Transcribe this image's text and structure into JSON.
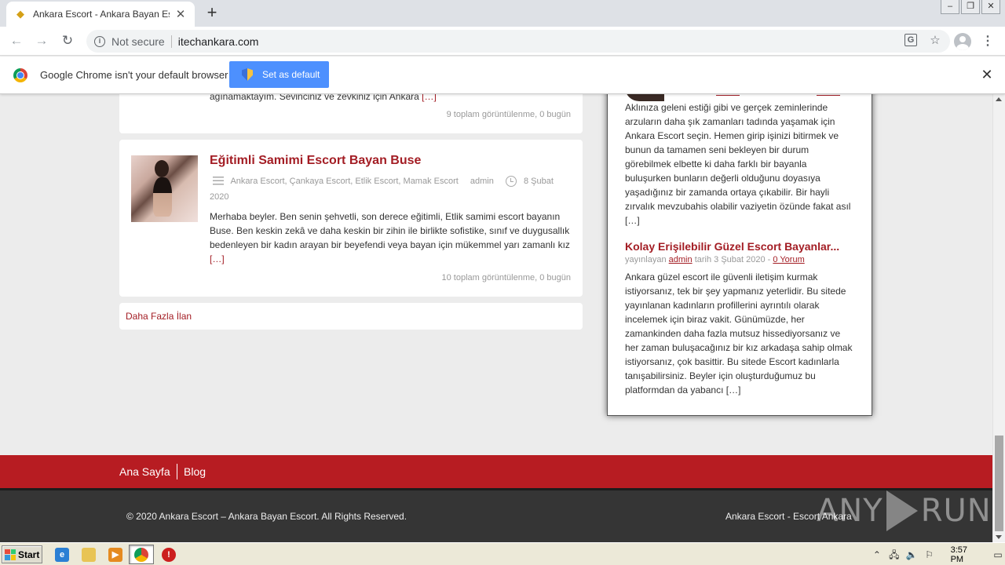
{
  "browser": {
    "tab_title": "Ankara Escort - Ankara Bayan Escort",
    "tab_close": "✕",
    "new_tab": "+",
    "not_secure": "Not secure",
    "url": "itechankara.com"
  },
  "infobar": {
    "message": "Google Chrome isn't your default browser",
    "button": "Set as default",
    "close": "✕"
  },
  "page": {
    "prev_post": {
      "excerpt_tail": "ağınamaktayım. Sevinciniz ve zevkiniz için Ankara",
      "more": "[…]",
      "views": "9 toplam görüntülenme, 0 bugün"
    },
    "post": {
      "title": "Eğitimli Samimi Escort Bayan Buse",
      "categories": "Ankara Escort, Çankaya Escort, Etlik Escort, Mamak Escort",
      "author": "admin",
      "date": "8 Şubat 2020",
      "excerpt": "Merhaba beyler. Ben senin şehvetli, son derece eğitimli, Etlik samimi escort bayanın Buse.  Ben keskin zekâ ve daha keskin bir zihin ile birlikte sofistike, sınıf ve duygusallık bedenleyen bir kadın arayan bir beyefendi veya bayan için mükemmel yarı zamanlı kız",
      "more": "[…]",
      "views": "10 toplam görüntülenme, 0 bugün"
    },
    "more_listings": "Daha Fazla İlan"
  },
  "sidebar": {
    "first_excerpt": "Aklınıza geleni estiği gibi ve gerçek zeminlerinde arzuların daha şık zamanları tadında yaşamak için Ankara Escort seçin. Hemen girip işinizi bitirmek ve bunun da tamamen seni bekleyen bir durum görebilmek elbette ki daha farklı bir bayanla buluşurken bunların değerli olduğunu doyasıya yaşadığınız bir zamanda ortaya çıkabilir. Bir hayli zırvalık mevzubahis olabilir vaziyetin özünde fakat asıl […]",
    "second": {
      "title": "Kolay Erişilebilir Güzel Escort Bayanlar...",
      "meta_prefix": "yayınlayan",
      "author": "admin",
      "meta_mid": "tarih 3 Şubat 2020 -",
      "comments": "0 Yorum",
      "excerpt": "Ankara güzel escort ile güvenli iletişim kurmak istiyorsanız, tek bir şey yapmanız yeterlidir. Bu sitede yayınlanan kadınların profillerini ayrıntılı olarak incelemek için biraz vakit. Günümüzde, her zamankinden daha fazla mutsuz hissediyorsanız ve her zaman buluşacağınız bir kız arkadaşa sahip olmak istiyorsanız, çok basittir. Bu sitede Escort kadınlarla tanışabilirsiniz.  Beyler için oluşturduğumuz bu platformdan da yabancı […]"
    }
  },
  "footer": {
    "nav": [
      "Ana Sayfa",
      "Blog"
    ],
    "copyright": "© 2020 Ankara Escort – Ankara Bayan Escort. All Rights Reserved.",
    "right": "Ankara Escort - Escort Ankara",
    "watermark_left": "ANY",
    "watermark_right": "RUN"
  },
  "taskbar": {
    "start": "Start",
    "clock": "3:57 PM"
  },
  "colors": {
    "accent": "#a31d24",
    "footer_red": "#b71c22",
    "chrome_blue": "#4d90fe"
  }
}
